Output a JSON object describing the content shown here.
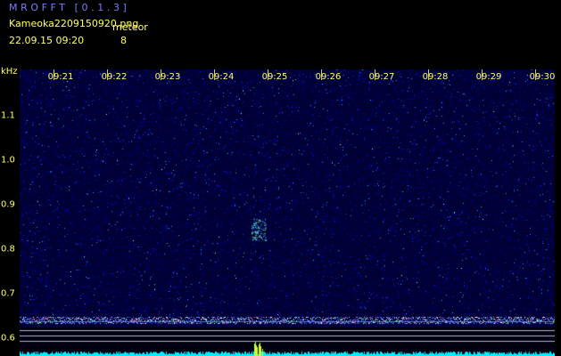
{
  "app": {
    "title": "MROFFT [0.1.3]"
  },
  "info": {
    "filename": "Kameoka2209150920.png",
    "datetime": "22.09.15 09:20",
    "label": "meteor",
    "count": "8"
  },
  "axis": {
    "unit": "kHz",
    "x_ticks": [
      "09:21",
      "09:22",
      "09:23",
      "09:24",
      "09:25",
      "09:26",
      "09:27",
      "09:28",
      "09:29",
      "09:30"
    ],
    "y_ticks": [
      "1.1",
      "1.0",
      "0.9",
      "0.8",
      "0.7",
      "0.6"
    ]
  },
  "colors": {
    "text": "#ffff66",
    "title": "#7b7bff",
    "background": "#000000",
    "noise_low": "#000066",
    "noise_high": "#4488ff",
    "signal": "#ff66aa",
    "baseline": "#00eeff",
    "burst": "#ccff33"
  }
}
